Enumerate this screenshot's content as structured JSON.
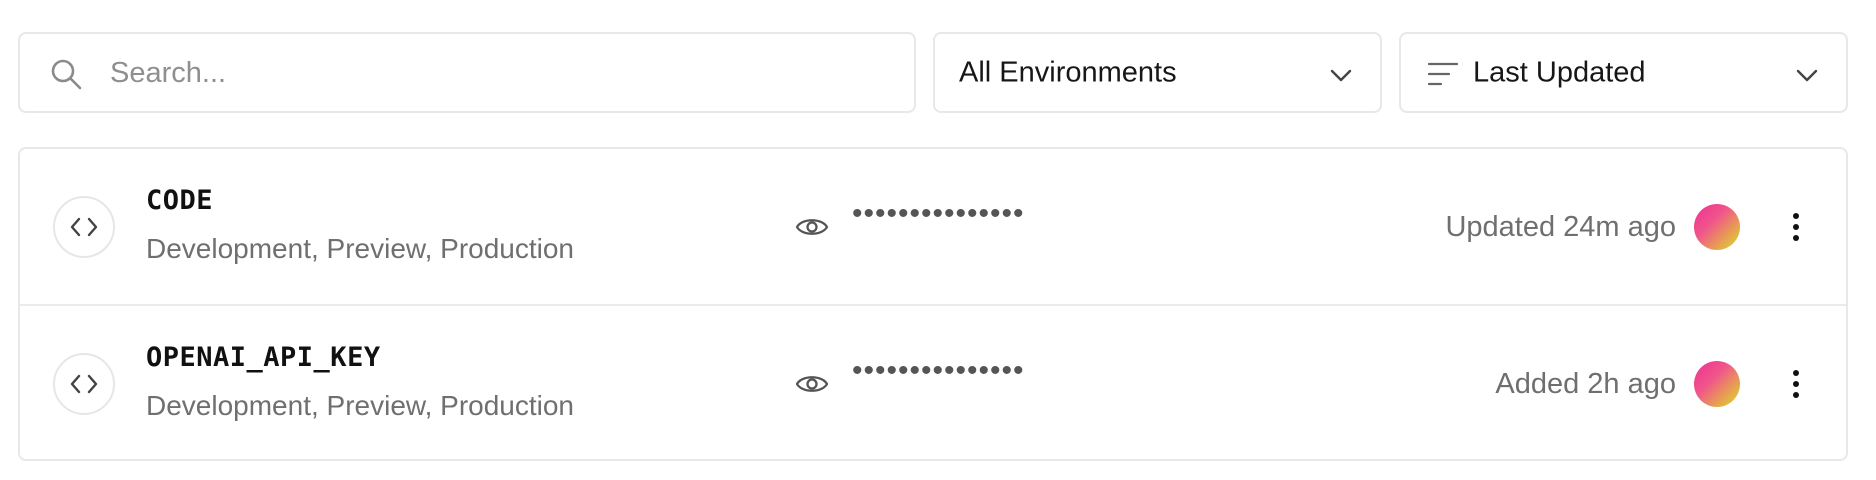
{
  "search": {
    "placeholder": "Search...",
    "value": "",
    "icon": "search-icon"
  },
  "environment_filter": {
    "selected": "All Environments",
    "icon": "chevron-down-icon"
  },
  "sort": {
    "selected": "Last Updated",
    "icon": "sort-lines-icon"
  },
  "variables": [
    {
      "name": "CODE",
      "environments": "Development, Preview, Production",
      "masked_value": "•••••••••••••••",
      "status": "Updated 24m ago",
      "icon": "code-icon"
    },
    {
      "name": "OPENAI_API_KEY",
      "environments": "Development, Preview, Production",
      "masked_value": "•••••••••••••••",
      "status": "Added 2h ago",
      "icon": "code-icon"
    }
  ],
  "colors": {
    "border": "#e8e8e8",
    "muted_text": "#6f6f6f",
    "avatar_gradient": [
      "#ee2f94",
      "#d8dd2c"
    ]
  }
}
